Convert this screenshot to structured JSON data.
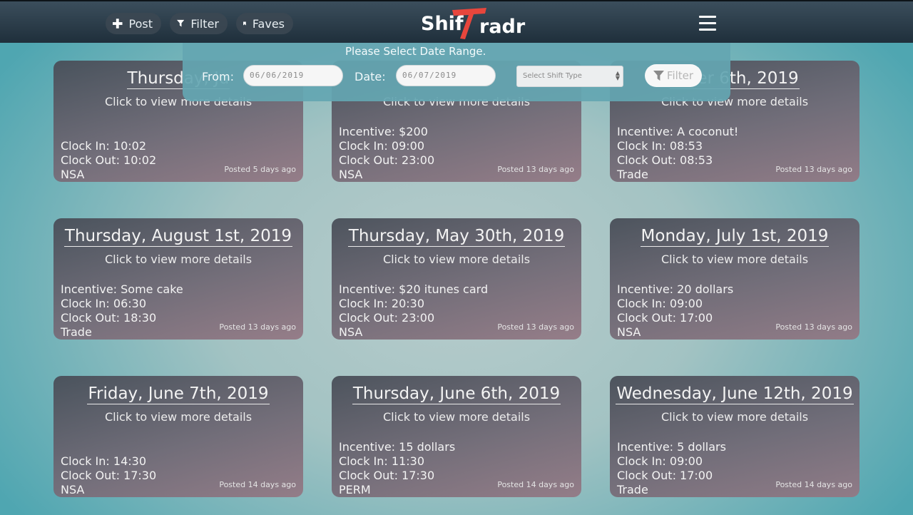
{
  "nav": {
    "post_label": "Post",
    "filter_label": "Filter",
    "faves_label": "Faves",
    "logo_part1": "Shif",
    "logo_t": "T",
    "logo_part2": "radr",
    "logo_accent": "#e8463c"
  },
  "filter_panel": {
    "title": "Please Select Date Range.",
    "from_label": "From:",
    "from_value": "06/06/2019",
    "date_label": "Date:",
    "date_value": "06/07/2019",
    "shift_type_placeholder": "Select Shift Type",
    "filter_button": "Filter"
  },
  "cards": [
    {
      "date": "Thursday, Ju",
      "sub": "Click to view more details",
      "incentive": "",
      "clock_in": "Clock In: 10:02",
      "clock_out": "Clock Out: 10:02",
      "type": "NSA",
      "posted": "Posted 5 days ago"
    },
    {
      "date": "",
      "sub": "Click to view more details",
      "incentive": "Incentive: $200",
      "clock_in": "Clock In: 09:00",
      "clock_out": "Clock Out: 23:00",
      "type": "NSA",
      "posted": "Posted 13 days ago"
    },
    {
      "date": "mber 6th, 2019",
      "sub": "Click to view more details",
      "incentive": "Incentive: A coconut!",
      "clock_in": "Clock In: 08:53",
      "clock_out": "Clock Out: 08:53",
      "type": "Trade",
      "posted": "Posted 13 days ago"
    },
    {
      "date": "Thursday, August 1st, 2019",
      "sub": "Click to view more details",
      "incentive": "Incentive: Some cake",
      "clock_in": "Clock In: 06:30",
      "clock_out": "Clock Out: 18:30",
      "type": "Trade",
      "posted": "Posted 13 days ago"
    },
    {
      "date": "Thursday, May 30th, 2019",
      "sub": "Click to view more details",
      "incentive": "Incentive: $20 itunes card",
      "clock_in": "Clock In: 20:30",
      "clock_out": "Clock Out: 23:00",
      "type": "NSA",
      "posted": "Posted 13 days ago"
    },
    {
      "date": "Monday, July 1st, 2019",
      "sub": "Click to view more details",
      "incentive": "Incentive: 20 dollars",
      "clock_in": "Clock In: 09:00",
      "clock_out": "Clock Out: 17:00",
      "type": "NSA",
      "posted": "Posted 13 days ago"
    },
    {
      "date": "Friday, June 7th, 2019",
      "sub": "Click to view more details",
      "incentive": "",
      "clock_in": "Clock In: 14:30",
      "clock_out": "Clock Out: 17:30",
      "type": "NSA",
      "posted": "Posted 14 days ago"
    },
    {
      "date": "Thursday, June 6th, 2019",
      "sub": "Click to view more details",
      "incentive": "Incentive: 15 dollars",
      "clock_in": "Clock In: 11:30",
      "clock_out": "Clock Out: 17:30",
      "type": "PERM",
      "posted": "Posted 14 days ago"
    },
    {
      "date": "Wednesday, June 12th, 2019",
      "sub": "Click to view more details",
      "incentive": "Incentive: 5 dollars",
      "clock_in": "Clock In: 09:00",
      "clock_out": "Clock Out: 17:00",
      "type": "Trade",
      "posted": "Posted 14 days ago"
    }
  ]
}
